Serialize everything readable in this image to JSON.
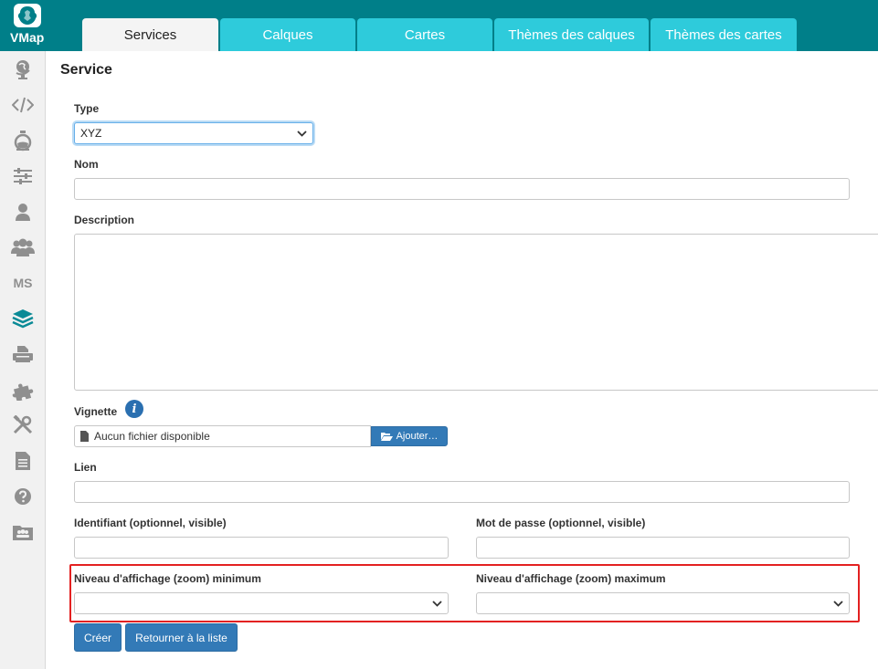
{
  "app": {
    "brand": "VMap"
  },
  "tabs": [
    {
      "label": "Services",
      "active": true
    },
    {
      "label": "Calques",
      "active": false
    },
    {
      "label": "Cartes",
      "active": false
    },
    {
      "label": "Thèmes des calques",
      "active": false
    },
    {
      "label": "Thèmes des cartes",
      "active": false
    }
  ],
  "sidebar": {
    "items": [
      {
        "icon": "globe-icon"
      },
      {
        "icon": "code-icon"
      },
      {
        "icon": "flask-icon"
      },
      {
        "icon": "sliders-icon"
      },
      {
        "icon": "user-icon"
      },
      {
        "icon": "users-icon"
      },
      {
        "icon": "ms-text",
        "label": "MS"
      },
      {
        "icon": "layers-icon"
      },
      {
        "icon": "printer-icon"
      },
      {
        "icon": "puzzle-icon"
      },
      {
        "icon": "tools-icon"
      },
      {
        "icon": "document-icon"
      },
      {
        "icon": "help-icon"
      },
      {
        "icon": "folder-users-icon"
      }
    ]
  },
  "form": {
    "title": "Service",
    "type_label": "Type",
    "type_value": "XYZ",
    "nom_label": "Nom",
    "nom_value": "",
    "description_label": "Description",
    "description_value": "",
    "vignette_label": "Vignette",
    "vignette_info_glyph": "i",
    "vignette_file_text": "Aucun fichier disponible",
    "vignette_button": "Ajouter…",
    "lien_label": "Lien",
    "lien_value": "",
    "identifiant_label": "Identifiant (optionnel, visible)",
    "identifiant_value": "",
    "password_label": "Mot de passe (optionnel, visible)",
    "password_value": "",
    "zoom_min_label": "Niveau d'affichage (zoom) minimum",
    "zoom_min_value": "",
    "zoom_max_label": "Niveau d'affichage (zoom) maximum",
    "zoom_max_value": "",
    "create_button": "Créer",
    "back_button": "Retourner à la liste"
  },
  "colors": {
    "topbar": "#007f89",
    "tab": "#2ecbdb",
    "tab_active": "#f4f4f4",
    "primary_button": "#337ab7",
    "highlight": "#e32121",
    "sidebar_icon": "#8f8f8f",
    "sidebar_icon_active": "#0a8a96"
  }
}
